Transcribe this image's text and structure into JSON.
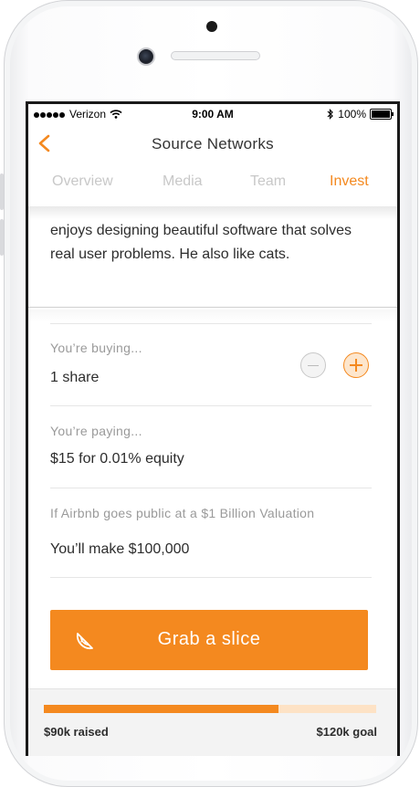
{
  "status_bar": {
    "carrier": "Verizon",
    "time": "9:00 AM",
    "battery": "100%"
  },
  "nav": {
    "title": "Source Networks"
  },
  "tabs": [
    {
      "label": "Overview",
      "active": false
    },
    {
      "label": "Media",
      "active": false
    },
    {
      "label": "Team",
      "active": false
    },
    {
      "label": "Invest",
      "active": true
    }
  ],
  "bio": {
    "text": "enjoys designing beautiful software that solves real user problems. He also like cats."
  },
  "buying": {
    "label": "You’re buying...",
    "value": "1 share"
  },
  "paying": {
    "label": "You’re paying...",
    "value": "$15 for 0.01% equity"
  },
  "projection": {
    "label": "If Airbnb goes public at a $1 Billion Valuation",
    "value": "You’ll make $100,000"
  },
  "cta": {
    "label": "Grab a slice",
    "icon": "orange-slice-icon"
  },
  "funding": {
    "raised_label": "$90k raised",
    "goal_label": "$120k goal",
    "progress": 0.705
  },
  "colors": {
    "accent": "#f4891f",
    "accent_light": "#fde2c5",
    "text": "#2d2d2d",
    "muted": "#9a9a9a"
  }
}
